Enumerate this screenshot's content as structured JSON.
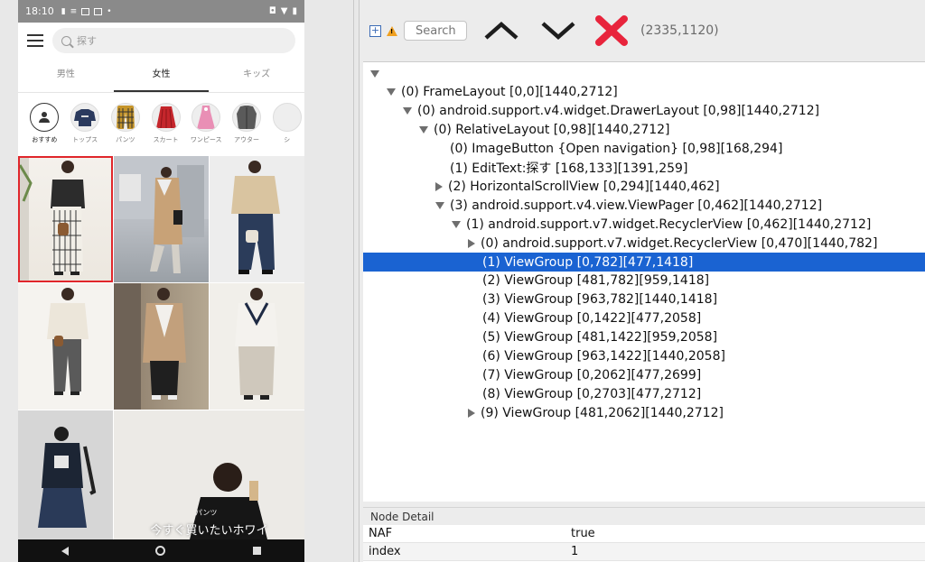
{
  "status_bar": {
    "time": "18:10"
  },
  "search": {
    "placeholder": "探す"
  },
  "gender_tabs": [
    {
      "label": "男性",
      "active": false
    },
    {
      "label": "女性",
      "active": true
    },
    {
      "label": "キッズ",
      "active": false
    }
  ],
  "categories": [
    {
      "label": "おすすめ",
      "active": true
    },
    {
      "label": "トップス"
    },
    {
      "label": "パンツ"
    },
    {
      "label": "スカート"
    },
    {
      "label": "ワンピース"
    },
    {
      "label": "アウター"
    },
    {
      "label": "シ"
    }
  ],
  "feed": {
    "caption_tag": "パンツ",
    "caption": "今すぐ買いたいホワイ"
  },
  "toolbar": {
    "search_placeholder": "Search",
    "coords": "(2335,1120)"
  },
  "tree": {
    "rows": [
      {
        "text": "",
        "depth": 0,
        "toggle": "down"
      },
      {
        "text": "(0) FrameLayout [0,0][1440,2712]",
        "depth": 1,
        "toggle": "down"
      },
      {
        "text": "(0) android.support.v4.widget.DrawerLayout [0,98][1440,2712]",
        "depth": 2,
        "toggle": "down"
      },
      {
        "text": "(0) RelativeLayout [0,98][1440,2712]",
        "depth": 3,
        "toggle": "down"
      },
      {
        "text": "(0) ImageButton {Open navigation} [0,98][168,294]",
        "depth": 4,
        "toggle": "none"
      },
      {
        "text": "(1) EditText:探す [168,133][1391,259]",
        "depth": 4,
        "toggle": "none"
      },
      {
        "text": "(2) HorizontalScrollView [0,294][1440,462]",
        "depth": 4,
        "toggle": "right"
      },
      {
        "text": "(3) android.support.v4.view.ViewPager [0,462][1440,2712]",
        "depth": 4,
        "toggle": "down"
      },
      {
        "text": "(1) android.support.v7.widget.RecyclerView [0,462][1440,2712]",
        "depth": 5,
        "toggle": "down"
      },
      {
        "text": "(0) android.support.v7.widget.RecyclerView [0,470][1440,782]",
        "depth": 6,
        "toggle": "right"
      },
      {
        "text": "(1) ViewGroup [0,782][477,1418]",
        "depth": 6,
        "toggle": "none",
        "selected": true
      },
      {
        "text": "(2) ViewGroup [481,782][959,1418]",
        "depth": 6,
        "toggle": "none"
      },
      {
        "text": "(3) ViewGroup [963,782][1440,1418]",
        "depth": 6,
        "toggle": "none"
      },
      {
        "text": "(4) ViewGroup [0,1422][477,2058]",
        "depth": 6,
        "toggle": "none"
      },
      {
        "text": "(5) ViewGroup [481,1422][959,2058]",
        "depth": 6,
        "toggle": "none"
      },
      {
        "text": "(6) ViewGroup [963,1422][1440,2058]",
        "depth": 6,
        "toggle": "none"
      },
      {
        "text": "(7) ViewGroup [0,2062][477,2699]",
        "depth": 6,
        "toggle": "none"
      },
      {
        "text": "(8) ViewGroup [0,2703][477,2712]",
        "depth": 6,
        "toggle": "none"
      },
      {
        "text": "(9) ViewGroup [481,2062][1440,2712]",
        "depth": 6,
        "toggle": "right"
      }
    ]
  },
  "node_detail": {
    "title": "Node Detail",
    "rows": [
      {
        "key": "NAF",
        "value": "true"
      },
      {
        "key": "index",
        "value": "1"
      }
    ]
  },
  "colors": {
    "selection": "#1a63d2",
    "selected_outline": "#e0262b",
    "close_icon": "#e8243c"
  }
}
